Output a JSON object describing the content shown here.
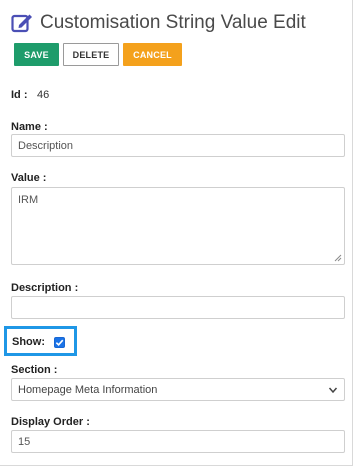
{
  "header": {
    "title": "Customisation String Value Edit",
    "icon": "edit-icon"
  },
  "toolbar": {
    "save_label": "SAVE",
    "delete_label": "DELETE",
    "cancel_label": "CANCEL"
  },
  "colors": {
    "save": "#1e9c6b",
    "cancel": "#f4a11c",
    "highlight": "#1f97e6",
    "checkbox": "#1a73e8"
  },
  "form": {
    "id_label": "Id :",
    "id_value": "46",
    "name_label": "Name :",
    "name_value": "Description",
    "value_label": "Value :",
    "value_value": "IRM",
    "description_label": "Description :",
    "description_value": "",
    "show_label": "Show:",
    "show_checked": true,
    "section_label": "Section :",
    "section_value": "Homepage Meta Information",
    "display_order_label": "Display Order :",
    "display_order_value": "15"
  }
}
